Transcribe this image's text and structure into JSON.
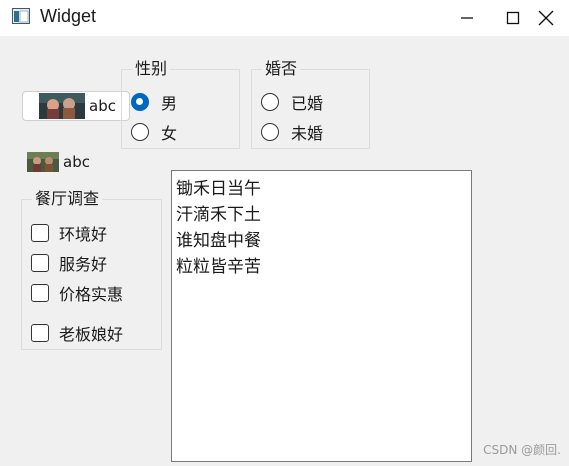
{
  "window": {
    "title": "Widget",
    "controls": {
      "minimize": "minimize",
      "maximize": "maximize",
      "close": "close"
    }
  },
  "tool_button": {
    "label": "abc",
    "icon": "anime-thumbnail"
  },
  "image_label": {
    "label": "abc",
    "icon": "anime-thumbnail"
  },
  "gender_group": {
    "title": "性别",
    "options": [
      {
        "label": "男",
        "checked": true
      },
      {
        "label": "女",
        "checked": false
      }
    ]
  },
  "marriage_group": {
    "title": "婚否",
    "options": [
      {
        "label": "已婚",
        "checked": false
      },
      {
        "label": "未婚",
        "checked": false
      }
    ]
  },
  "survey_group": {
    "title": "餐厅调查",
    "options": [
      {
        "label": "环境好",
        "checked": false
      },
      {
        "label": "服务好",
        "checked": false
      },
      {
        "label": "价格实惠",
        "checked": false
      },
      {
        "label": "老板娘好",
        "checked": false
      }
    ]
  },
  "text_edit": {
    "lines": [
      "锄禾日当午",
      "汗滴禾下土",
      "谁知盘中餐",
      "粒粒皆辛苦"
    ]
  },
  "watermark": "CSDN @颜回.",
  "colors": {
    "accent": "#0067c0",
    "background": "#f0f0f0"
  }
}
